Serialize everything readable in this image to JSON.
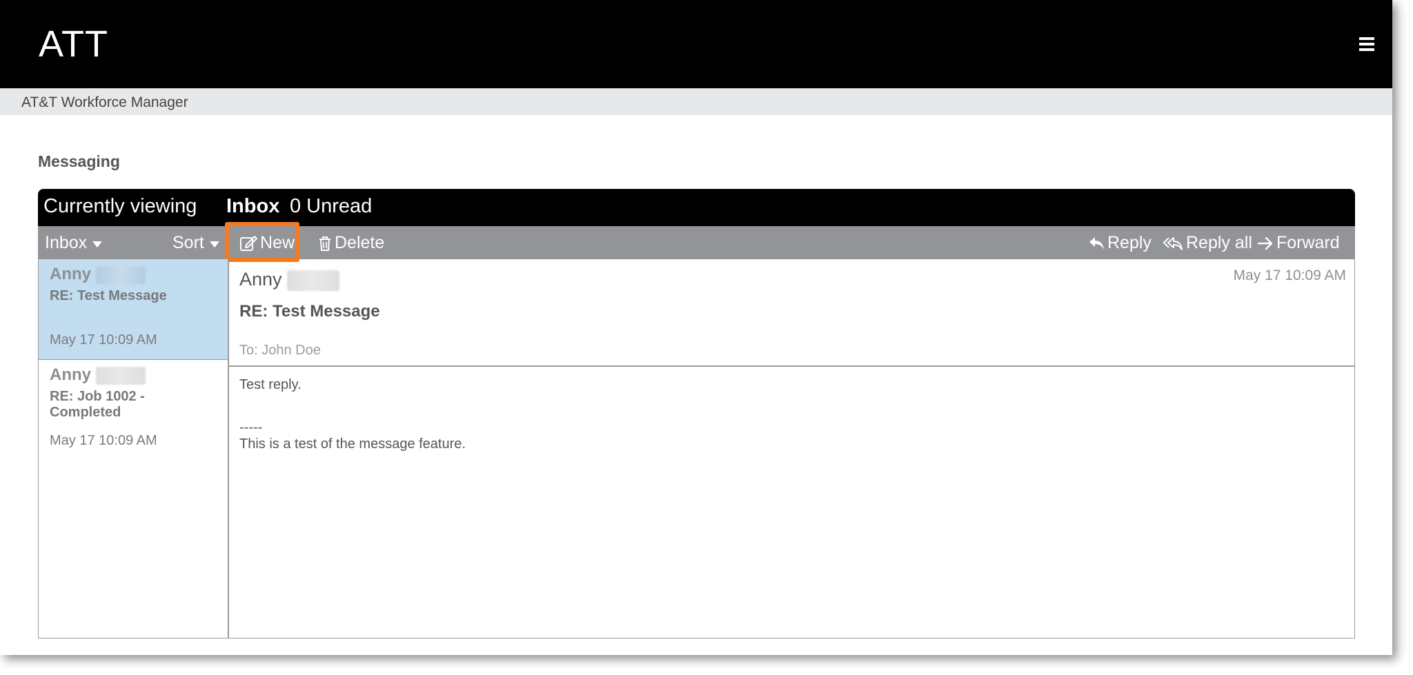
{
  "app": {
    "logo": "ATT",
    "subtitle": "AT&T Workforce Manager"
  },
  "page": {
    "title": "Messaging"
  },
  "viewing": {
    "label": "Currently viewing",
    "folder": "Inbox",
    "unread": "0 Unread"
  },
  "toolbar": {
    "folder_label": "Inbox",
    "sort_label": "Sort",
    "new_label": "New",
    "delete_label": "Delete",
    "reply_label": "Reply",
    "reply_all_label": "Reply all",
    "forward_label": "Forward"
  },
  "messages": [
    {
      "sender": "Anny",
      "subject": "RE: Test Message",
      "date": "May 17 10:09 AM",
      "selected": true
    },
    {
      "sender": "Anny",
      "subject": "RE: Job 1002 - Completed",
      "date": "May 17 10:09 AM",
      "selected": false
    }
  ],
  "reader": {
    "from": "Anny",
    "date": "May 17 10:09 AM",
    "subject": "RE: Test Message",
    "to": "To: John Doe",
    "body": {
      "reply": "Test reply.",
      "separator": "-----",
      "quoted": "This is a test of the message feature."
    }
  },
  "colors": {
    "header_bg": "#000000",
    "toolbar_bg": "#929497",
    "highlight": "#f47b20",
    "selected_row": "#c2dcf0"
  }
}
